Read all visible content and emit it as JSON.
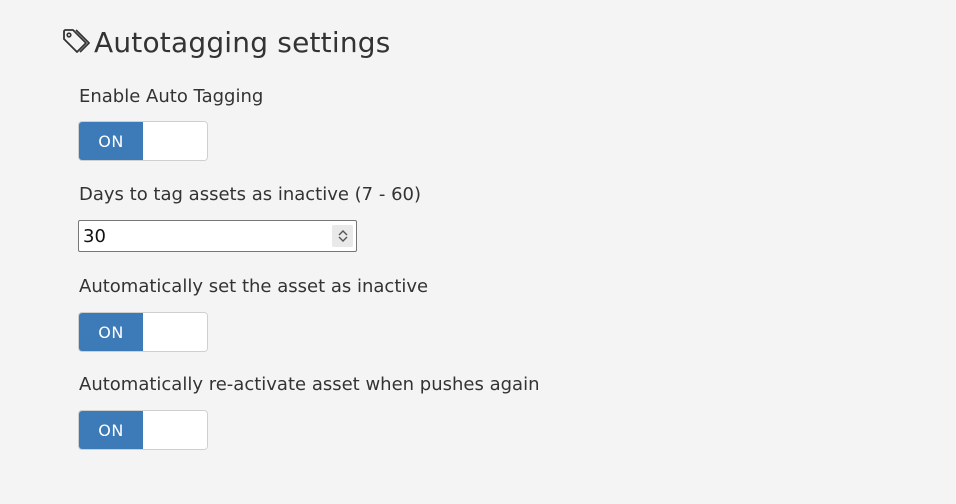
{
  "header": {
    "title": "Autotagging settings",
    "icon": "tag-icon"
  },
  "settings": {
    "enable_auto_tagging": {
      "label": "Enable Auto Tagging",
      "toggle_label": "ON",
      "enabled": true
    },
    "days_inactive": {
      "label": "Days to tag assets as inactive (7 - 60)",
      "value": "30"
    },
    "auto_set_inactive": {
      "label": "Automatically set the asset as inactive",
      "toggle_label": "ON",
      "enabled": true
    },
    "auto_reactivate": {
      "label": "Automatically re-activate asset when pushes again",
      "toggle_label": "ON",
      "enabled": true
    }
  },
  "colors": {
    "accent": "#3d7ab8",
    "background": "#f4f4f4",
    "text": "#333333"
  }
}
